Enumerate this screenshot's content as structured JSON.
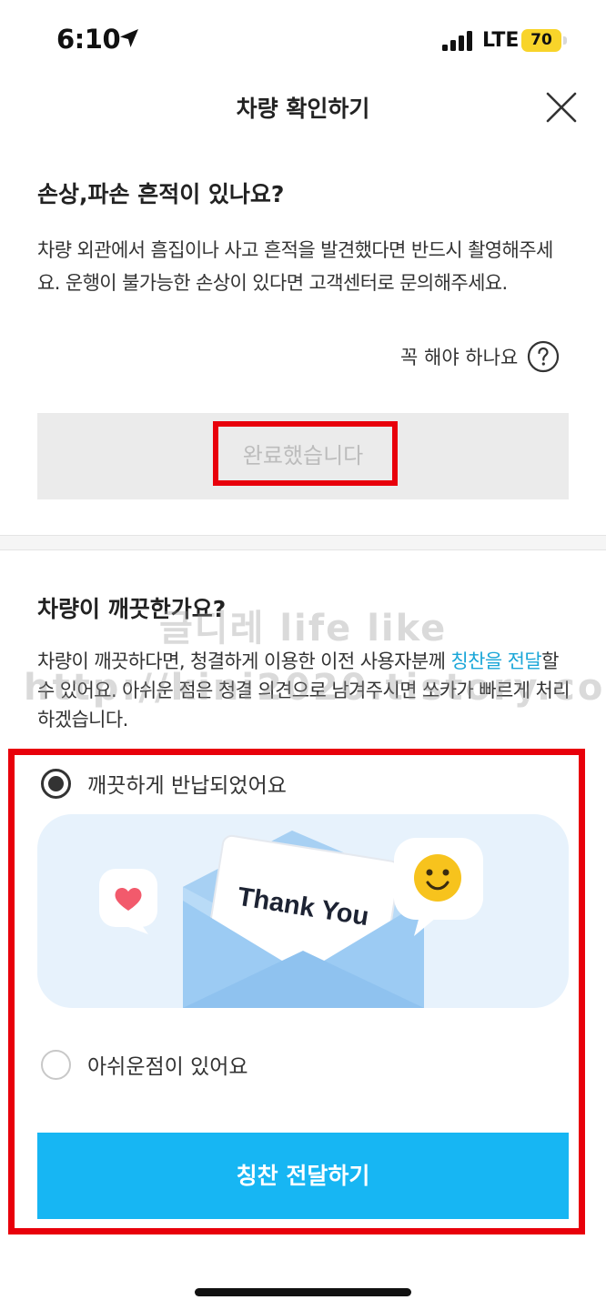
{
  "status_bar": {
    "time": "6:10",
    "carrier": "LTE",
    "battery": "70"
  },
  "header": {
    "title": "차량 확인하기"
  },
  "damage_section": {
    "title": "손상,파손 흔적이 있나요?",
    "description": "차량 외관에서 흠집이나 사고 흔적을 발견했다면 반드시 촬영해주세요. 운행이 불가능한 손상이 있다면 고객센터로 문의해주세요.",
    "must_link": "꼭 해야 하나요",
    "done_button": "완료했습니다"
  },
  "clean_section": {
    "title": "차량이 깨끗한가요?",
    "description_before": "차량이 깨끗하다면, 청결하게 이용한 이전 사용자분께 ",
    "description_highlight": "칭찬을 전달",
    "description_after": "할 수 있어요. 아쉬운 점은 청결 의견으로 남겨주시면 쏘카가 빠르게 처리하겠습니다.",
    "option_clean": "깨끗하게 반납되었어요",
    "option_issue": "아쉬운점이 있어요",
    "illustration_text": "Thank You",
    "praise_button": "칭찬 전달하기"
  },
  "watermark": {
    "line1": "글디레 life like",
    "line2": "http://kini2020.tistory.com"
  },
  "colors": {
    "accent": "#17b6f3",
    "link": "#1aa6d8",
    "highlight_box": "#e8000b",
    "battery": "#f8d42a"
  },
  "icons": [
    "location-arrow-icon",
    "signal-icon",
    "battery-icon",
    "close-icon",
    "help-icon",
    "heart-icon",
    "smiley-icon",
    "envelope-icon"
  ]
}
